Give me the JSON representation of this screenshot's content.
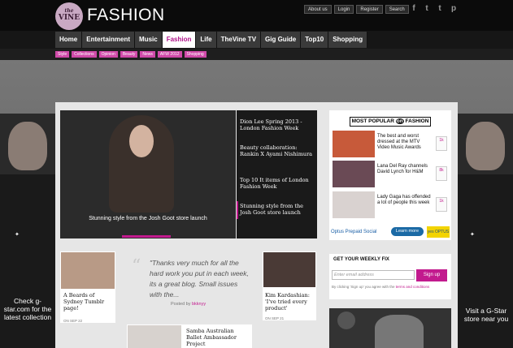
{
  "site": {
    "logo_small": "the",
    "logo_big": "VINE",
    "section": "FASHION"
  },
  "util": [
    "About us",
    "Login",
    "Register",
    "Search"
  ],
  "social": [
    "f",
    "t",
    "t",
    "p"
  ],
  "nav": [
    "Home",
    "Entertainment",
    "Music",
    "Fashion",
    "Life",
    "TheVine TV",
    "Gig Guide",
    "Top10",
    "Shopping"
  ],
  "subnav": [
    "Style",
    "Collections",
    "Opinion",
    "Beauty",
    "News",
    "AFW 2012",
    "Shopping"
  ],
  "hero": {
    "caption": "Stunning style from the Josh Goot store launch"
  },
  "hero_list": [
    "Dion Lee Spring 2013 - London Fashion Week",
    "Beauty collaboration: Rankin X Ayami Nishimura",
    "Top 10 It items of London Fashion Week",
    "Stunning style from the Josh Goot store launch"
  ],
  "most_popular": {
    "label_l": "MOST POPULAR",
    "label_icon": "on",
    "label_r": "FASHION",
    "items": [
      {
        "title": "The best and worst dressed at the MTV Video Music Awards",
        "count": "1k"
      },
      {
        "title": "Lana Del Ray channels David Lynch for H&M",
        "count": "8k"
      },
      {
        "title": "Lady Gaga has offended a lot of people this week",
        "count": "1k"
      }
    ]
  },
  "optus": {
    "label": "Optus Prepaid Social",
    "learn": "Learn more",
    "logo": "yes OPTUS"
  },
  "cards": [
    {
      "title": "A Beards of Sydney Tumblr page!",
      "date": "ON SEP 22"
    },
    {
      "title": "Kim Kardashian: 'I've tried every product'",
      "date": "ON SEP 21"
    },
    {
      "title": "Samba Australian Ballet Ambassador Project",
      "date": ""
    }
  ],
  "quote": {
    "text": "\"Thanks very much for all the hard work you put in each week, its a great blog. Small issues with the...",
    "by": "Posted by",
    "author": "bkknyy"
  },
  "fix": {
    "title": "GET YOUR WEEKLY FIX",
    "placeholder": "Enter email address",
    "signup": "Sign up",
    "small": "By clicking 'Sign up' you agree with the",
    "terms": "terms and conditions"
  },
  "left_ad": {
    "text": "Check g-star.com for the latest collection"
  },
  "right_ad": {
    "text": "Visit a G-Star store near you"
  }
}
